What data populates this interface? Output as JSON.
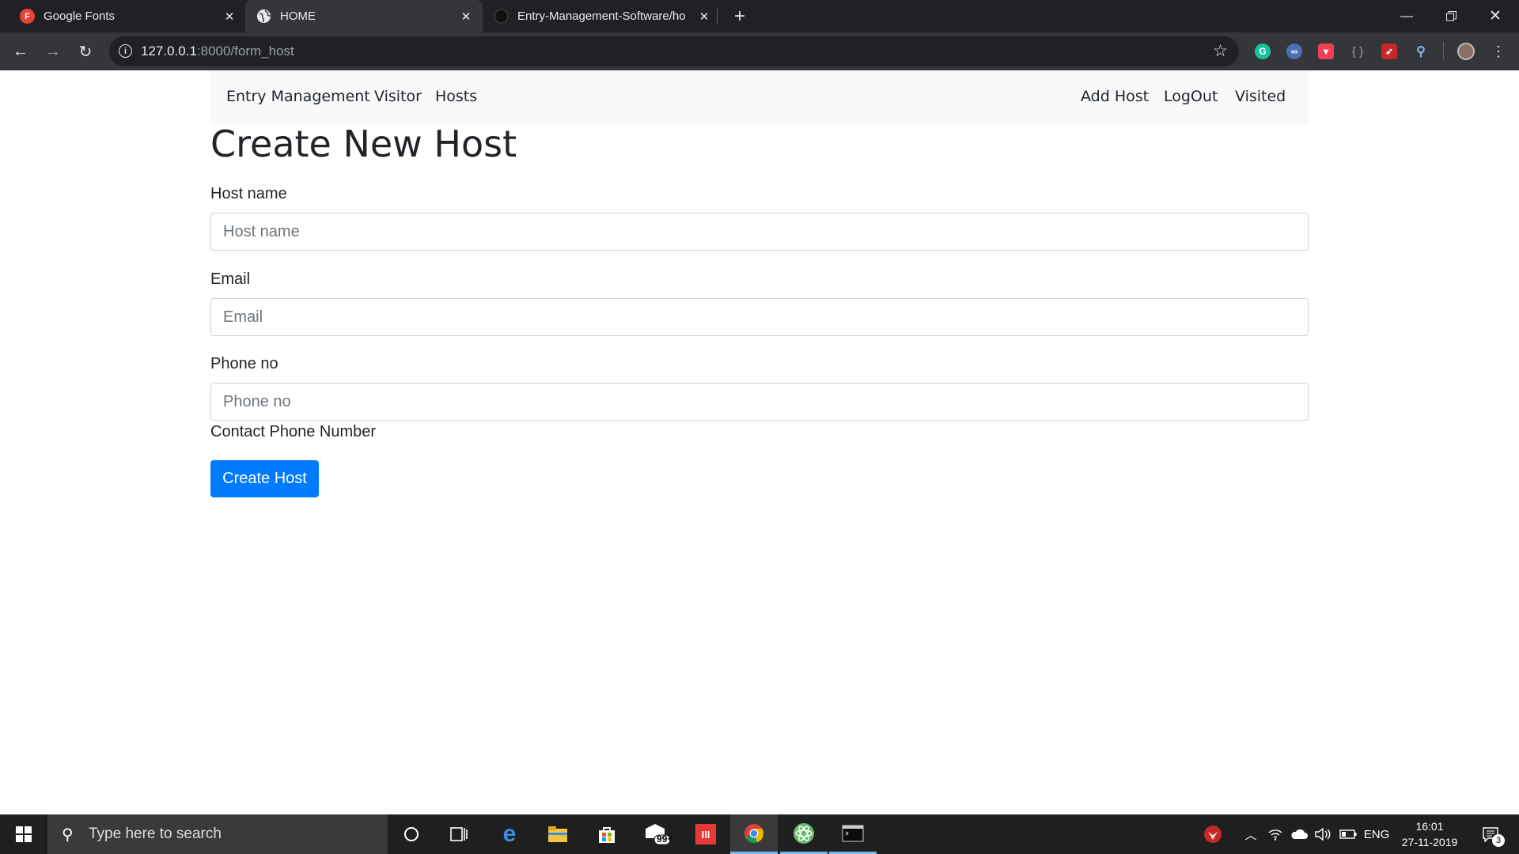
{
  "browser": {
    "tabs": [
      {
        "title": "Google Fonts",
        "favicon": "google-fonts-icon",
        "favicon_letter": "F",
        "active": false
      },
      {
        "title": "HOME",
        "favicon": "globe-icon",
        "active": true
      },
      {
        "title": "Entry-Management-Software/ho",
        "favicon": "github-icon",
        "active": false
      }
    ],
    "url_host": "127.0.0.1",
    "url_path": ":8000/form_host",
    "extensions": [
      "grammarly-icon",
      "extension-icon",
      "pocket-icon",
      "braces-icon",
      "rocket-icon",
      "search-extension-icon"
    ]
  },
  "navbar": {
    "brand": "Entry Management",
    "left_links": [
      "Visitor",
      "Hosts"
    ],
    "right_links": [
      "Add Host",
      "LogOut",
      "Visited"
    ]
  },
  "form": {
    "title": "Create New Host",
    "fields": [
      {
        "label": "Host name",
        "placeholder": "Host name",
        "value": ""
      },
      {
        "label": "Email",
        "placeholder": "Email",
        "value": ""
      },
      {
        "label": "Phone no",
        "placeholder": "Phone no",
        "value": ""
      }
    ],
    "phone_help": "Contact Phone Number",
    "submit_label": "Create Host"
  },
  "colors": {
    "primary_button": "#007bff",
    "navbar_bg": "#f8f9fa",
    "browser_frame": "#202124",
    "taskbar": "#1f1f1f"
  },
  "taskbar": {
    "search_placeholder": "Type here to search",
    "mail_badge": "99+",
    "notification_count": "3",
    "language": "ENG",
    "time": "16:01",
    "date": "27-11-2019"
  }
}
